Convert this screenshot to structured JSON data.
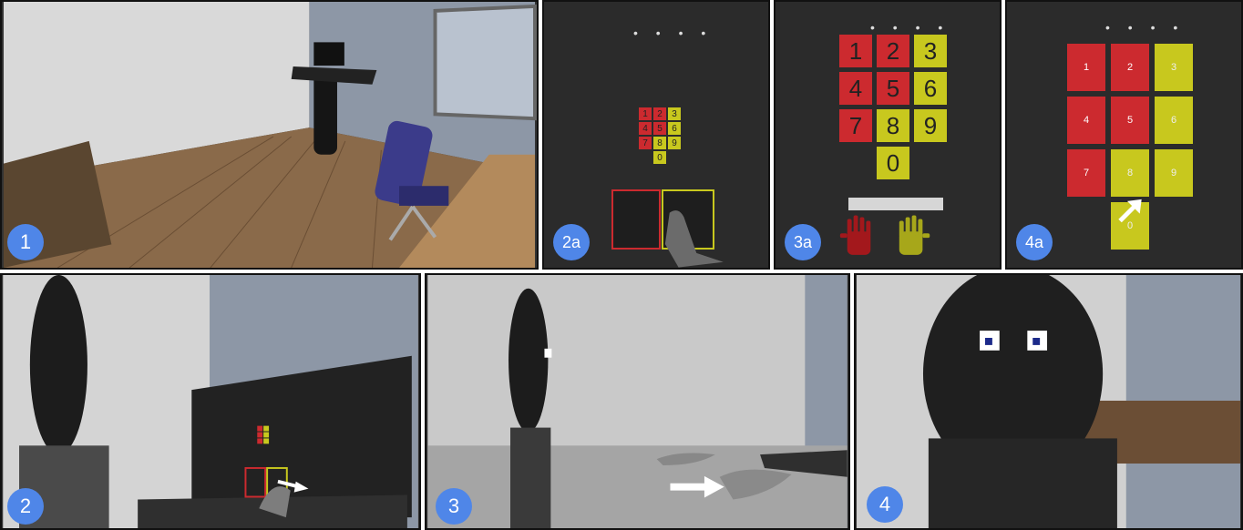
{
  "panels": {
    "p1": {
      "label": "1"
    },
    "p2a": {
      "label": "2a"
    },
    "p3a": {
      "label": "3a"
    },
    "p4a": {
      "label": "4a"
    },
    "p2": {
      "label": "2"
    },
    "p3": {
      "label": "3"
    },
    "p4": {
      "label": "4"
    }
  },
  "keypad": {
    "keys": [
      "1",
      "2",
      "3",
      "4",
      "5",
      "6",
      "7",
      "8",
      "9",
      "0"
    ],
    "pin_dots": "• • • •"
  },
  "colors": {
    "badge": "#4f86e8",
    "key_red": "#cc2a2f",
    "key_yellow": "#c8c81e",
    "board": "#2b2b2b"
  }
}
